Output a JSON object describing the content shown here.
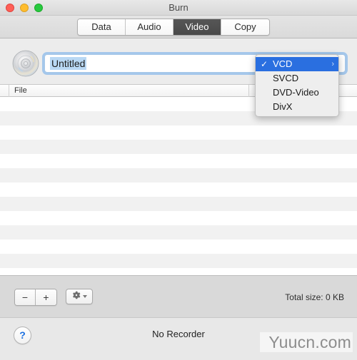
{
  "window": {
    "title": "Burn",
    "traffic_lights": [
      {
        "name": "close",
        "color": "#ff5f56"
      },
      {
        "name": "minimize",
        "color": "#ffbd2e"
      },
      {
        "name": "maximize",
        "color": "#27c93f"
      }
    ]
  },
  "tabs": [
    {
      "label": "Data",
      "active": false
    },
    {
      "label": "Audio",
      "active": false
    },
    {
      "label": "Video",
      "active": true
    },
    {
      "label": "Copy",
      "active": false
    }
  ],
  "disc": {
    "icon": "disc-icon",
    "name_field": {
      "value": "Untitled",
      "placeholder": "Untitled",
      "selected": true,
      "focused": true
    }
  },
  "file_list": {
    "columns": [
      "File"
    ],
    "rows": [],
    "empty": true
  },
  "format_menu": {
    "open": true,
    "items": [
      {
        "label": "VCD",
        "checked": true,
        "selected": true,
        "submenu": true
      },
      {
        "label": "SVCD",
        "checked": false,
        "selected": false,
        "submenu": false
      },
      {
        "label": "DVD-Video",
        "checked": false,
        "selected": false,
        "submenu": false
      },
      {
        "label": "DivX",
        "checked": false,
        "selected": false,
        "submenu": false
      }
    ],
    "check_glyph": "✓",
    "chevron_glyph": "›",
    "highlight_color": "#2a6fe0"
  },
  "button_bar": {
    "remove_label": "−",
    "add_label": "+",
    "gear_icon": "gear-icon",
    "total_size": "Total size: 0 KB"
  },
  "status_bar": {
    "help_label": "?",
    "recorder_status": "No Recorder",
    "watermark": "Yuucn.com"
  }
}
